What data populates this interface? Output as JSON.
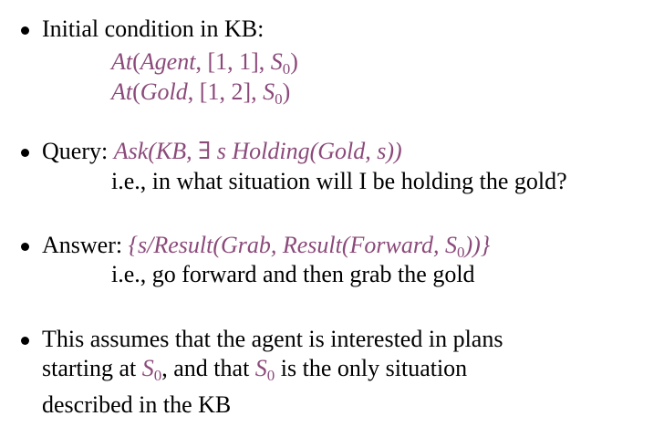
{
  "bullets": {
    "b1": {
      "label": "Initial condition in KB:",
      "line1": {
        "pred": "At",
        "open": "(",
        "arg1": "Agent",
        "mid": ", [1, 1], ",
        "s": "S",
        "sub": "0",
        "close": ")"
      },
      "line2": {
        "pred": "At",
        "open": "(",
        "arg1": "Gold",
        "mid": ", [1, 2], ",
        "s": "S",
        "sub": "0",
        "close": ")"
      }
    },
    "b2": {
      "label": "Query:",
      "math_pre": "Ask(KB, ∃ s  Holding(Gold, s))",
      "explain": "i.e., in what situation will I be holding the gold?"
    },
    "b3": {
      "label": "Answer:",
      "math_pre": "{s/Result(Grab, Result(Forward, S",
      "math_sub": "0",
      "math_post": "))}",
      "explain": "i.e., go forward and then grab the gold"
    },
    "b4": {
      "line1": "This assumes that the agent is interested in plans",
      "line2_pre": "starting at ",
      "s": "S",
      "sub": "0",
      "line2_mid": ",  and that ",
      "line2_post": " is the only situation",
      "line3": "described in the KB"
    }
  }
}
